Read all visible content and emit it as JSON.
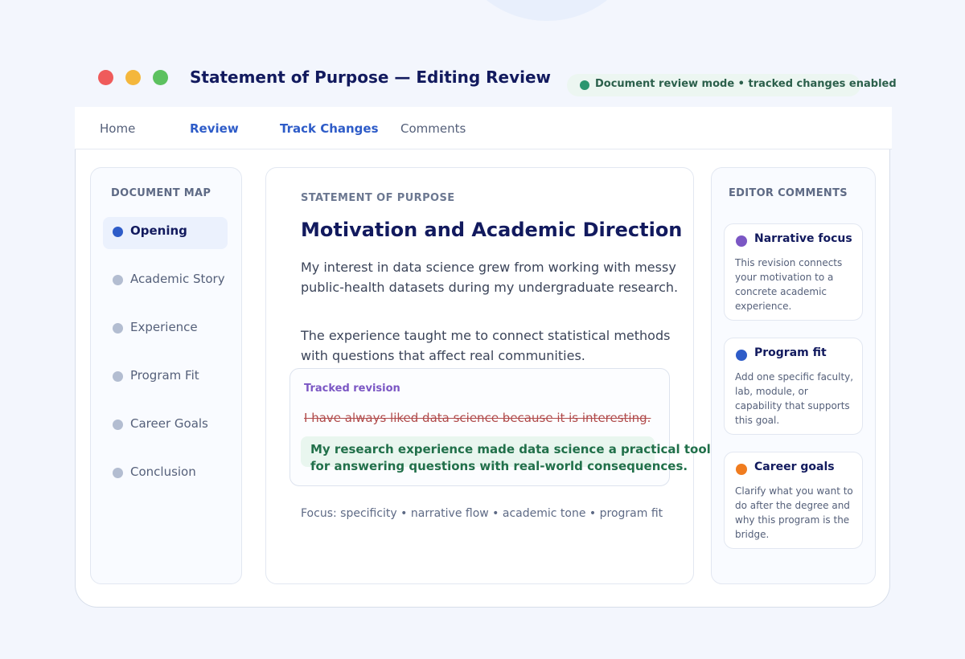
{
  "window": {
    "title": "Statement of Purpose — Editing Review",
    "status": "Document review mode • tracked changes enabled"
  },
  "tabs": [
    {
      "label": "Home",
      "active": false
    },
    {
      "label": "Review",
      "active": true
    },
    {
      "label": "Track Changes",
      "active": true
    },
    {
      "label": "Comments",
      "active": false
    }
  ],
  "sidebar": {
    "heading": "DOCUMENT MAP",
    "items": [
      {
        "label": "Opening",
        "active": true
      },
      {
        "label": "Academic Story",
        "active": false
      },
      {
        "label": "Experience",
        "active": false
      },
      {
        "label": "Program Fit",
        "active": false
      },
      {
        "label": "Career Goals",
        "active": false
      },
      {
        "label": "Conclusion",
        "active": false
      }
    ]
  },
  "document": {
    "eyebrow": "STATEMENT OF PURPOSE",
    "heading": "Motivation and Academic Direction",
    "paragraphs": [
      "My interest in data science grew from working with messy public-health datasets during my undergraduate research.",
      "The experience taught me to connect statistical methods with questions that affect real communities."
    ],
    "revision": {
      "label": "Tracked revision",
      "deleted": "I have always liked data science because it is interesting.",
      "added": "My research experience made data science a practical tool for answering questions with real-world consequences."
    },
    "focus": "Focus: specificity • narrative flow • academic tone • program fit"
  },
  "comments": {
    "heading": "EDITOR COMMENTS",
    "items": [
      {
        "title": "Narrative focus",
        "body": "This revision connects your motivation to a concrete academic experience.",
        "color": "#7b57c4"
      },
      {
        "title": "Program fit",
        "body": "Add one specific faculty, lab, module, or capability that supports this goal.",
        "color": "#2e5cc8"
      },
      {
        "title": "Career goals",
        "body": "Clarify what you want to do after the degree and why this program is the bridge.",
        "color": "#f07c1f"
      }
    ]
  },
  "colors": {
    "accent": "#2e5cc8",
    "title": "#121a5e",
    "deleted": "#b04a4a",
    "added": "#21704a",
    "status": "#2b9670"
  }
}
